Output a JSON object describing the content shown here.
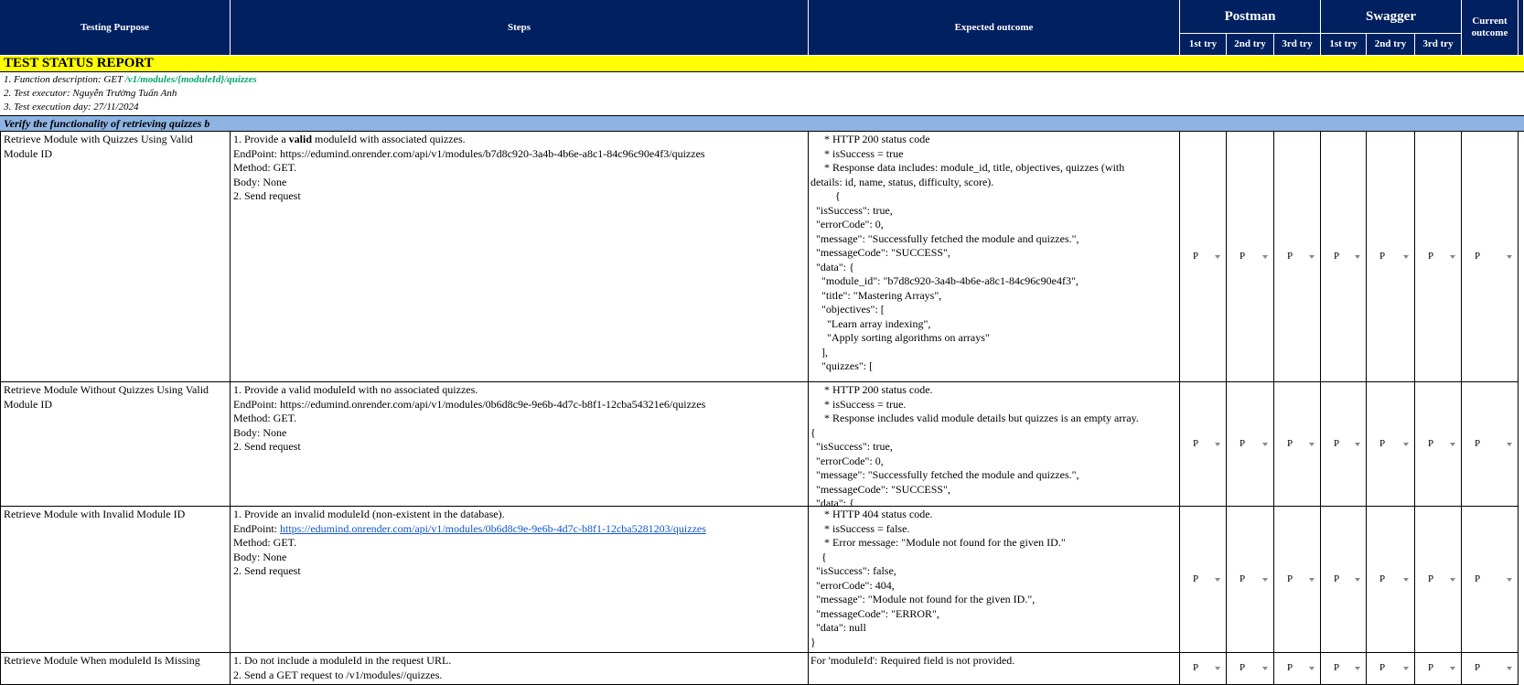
{
  "header": {
    "testing_purpose": "Testing Purpose",
    "steps": "Steps",
    "expected_outcome": "Expected outcome",
    "postman": "Postman",
    "swagger": "Swagger",
    "current_outcome": "Current outcome",
    "tries": [
      "1st try",
      "2nd try",
      "3rd try",
      "1st try",
      "2nd try",
      "3rd try"
    ]
  },
  "report": {
    "title": "TEST STATUS REPORT",
    "function_prefix": "1. Function description: GET",
    "function_path": "/v1/modules/{moduleId}/quizzes",
    "executor": "2. Test executor:  Nguyễn Trường Tuấn Anh",
    "execution_day": "3. Test execution day: 27/11/2024",
    "section": "Verify the functionality of retrieving quizzes b"
  },
  "rows": [
    {
      "purpose": "Retrieve Module with Quizzes Using Valid Module ID",
      "step1_pre": "1. Provide a ",
      "step1_bold": "valid",
      "step1_post": " moduleId with associated quizzes.",
      "endpoint_label": "EndPoint: ",
      "endpoint": "https://edumind.onrender.com/api/v1/modules/b7d8c920-3a4b-4b6e-a8c1-84c96c90e4f3/quizzes",
      "method": "Method: GET.",
      "body": "Body: None",
      "send": "2. Send request",
      "expected": "     * HTTP 200 status code\n     * isSuccess = true\n     * Response data includes: module_id, title, objectives, quizzes (with\ndetails: id, name, status, difficulty, score).\n         {\n  \"isSuccess\": true,\n  \"errorCode\": 0,\n  \"message\": \"Successfully fetched the module and quizzes.\",\n  \"messageCode\": \"SUCCESS\",\n  \"data\": {\n    \"module_id\": \"b7d8c920-3a4b-4b6e-a8c1-84c96c90e4f3\",\n    \"title\": \"Mastering Arrays\",\n    \"objectives\": [\n      \"Learn array indexing\",\n      \"Apply sorting algorithms on arrays\"\n    ],\n    \"quizzes\": [",
      "results": [
        "P",
        "P",
        "P",
        "P",
        "P",
        "P",
        "P"
      ]
    },
    {
      "purpose": " Retrieve Module Without Quizzes Using Valid Module ID",
      "step1": "1. Provide a valid moduleId with no associated quizzes.",
      "endpoint_label": "EndPoint: ",
      "endpoint": "https://edumind.onrender.com/api/v1/modules/0b6d8c9e-9e6b-4d7c-b8f1-12cba54321e6/quizzes",
      "method": "Method: GET.",
      "body": "Body: None",
      "send": "2. Send request",
      "expected": "     * HTTP 200 status code.\n     * isSuccess = true.\n     * Response includes valid module details but quizzes is an empty array.\n{\n  \"isSuccess\": true,\n  \"errorCode\": 0,\n  \"message\": \"Successfully fetched the module and quizzes.\",\n  \"messageCode\": \"SUCCESS\",\n  \"data\": {",
      "results": [
        "P",
        "P",
        "P",
        "P",
        "P",
        "P",
        "P"
      ]
    },
    {
      "purpose": "Retrieve Module with Invalid Module ID",
      "step1": "1. Provide an invalid moduleId (non-existent in the database).",
      "endpoint_label": "EndPoint: ",
      "endpoint": "https://edumind.onrender.com/api/v1/modules/0b6d8c9e-9e6b-4d7c-b8f1-12cba5281203/quizzes",
      "method": "Method: GET.",
      "body": "Body: None",
      "send": "2. Send request",
      "expected": "     * HTTP 404 status code.\n     * isSuccess = false.\n     * Error message: \"Module not found for the given ID.\"\n    {\n  \"isSuccess\": false,\n  \"errorCode\": 404,\n  \"message\": \"Module not found for the given ID.\",\n  \"messageCode\": \"ERROR\",\n  \"data\": null\n}",
      "results": [
        "P",
        "P",
        "P",
        "P",
        "P",
        "P",
        "P"
      ]
    },
    {
      "purpose": " Retrieve Module When moduleId Is Missing",
      "step1": "1. Do not include a moduleId in the request URL.",
      "step2": "2. Send a GET request to /v1/modules//quizzes.",
      "expected": "For 'moduleId': Required field is not provided.",
      "results": [
        "P",
        "P",
        "P",
        "P",
        "P",
        "P",
        "P"
      ]
    }
  ]
}
